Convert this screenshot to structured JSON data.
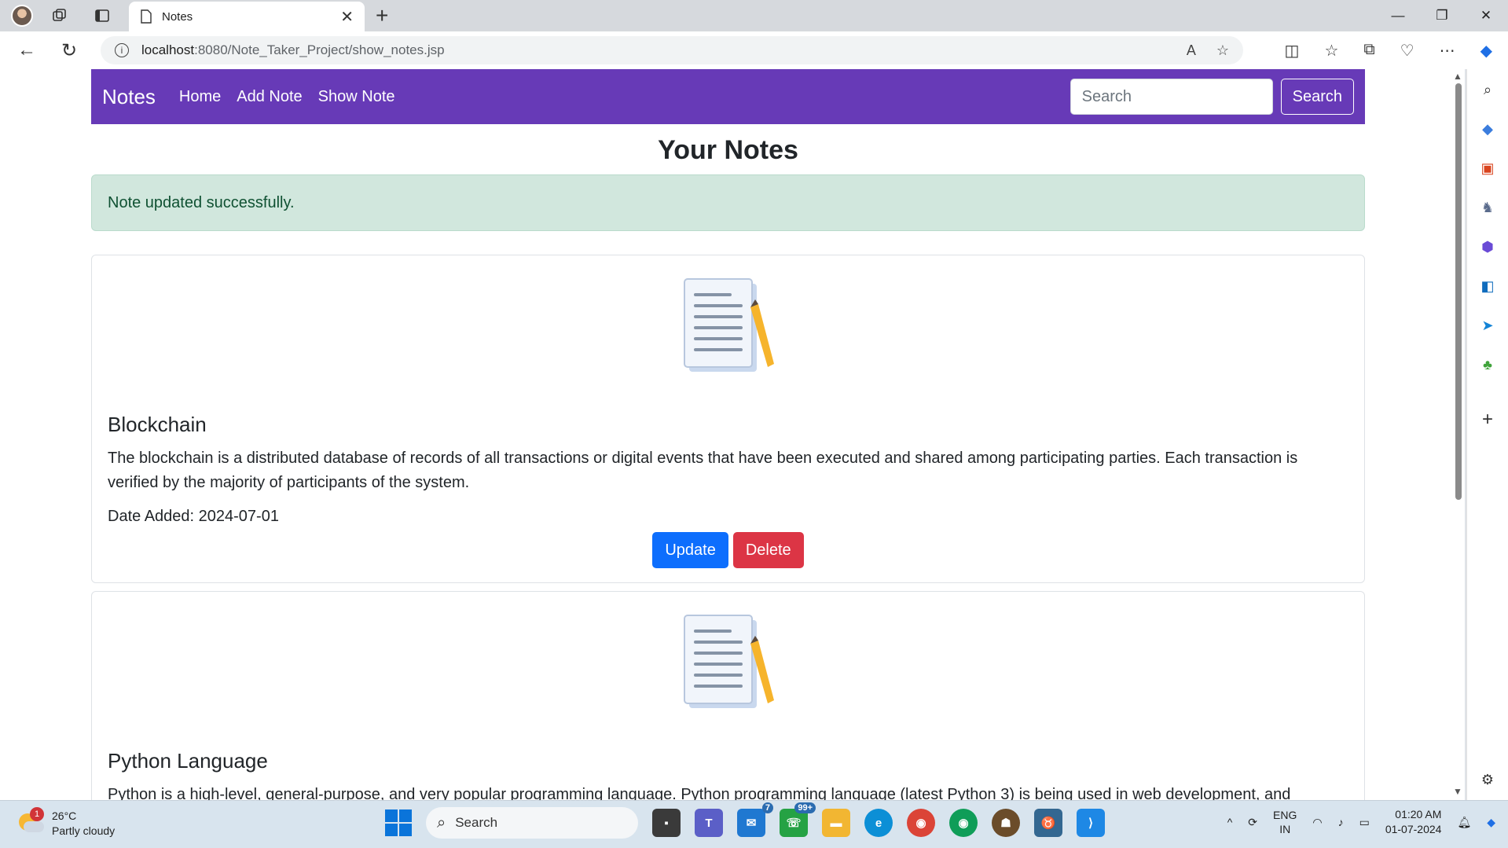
{
  "browser": {
    "tab_title": "Notes",
    "tab_close": "✕",
    "new_tab": "+",
    "url_host": "localhost",
    "url_path": ":8080/Note_Taker_Project/show_notes.jsp",
    "window_controls": [
      "—",
      "❐",
      "✕"
    ]
  },
  "navbar": {
    "brand": "Notes",
    "links": [
      "Home",
      "Add Note",
      "Show Note"
    ],
    "search_placeholder": "Search",
    "search_button": "Search",
    "background_color": "#673ab7"
  },
  "page": {
    "title": "Your Notes",
    "alert": "Note updated successfully."
  },
  "notes": [
    {
      "title": "Blockchain",
      "content": "The blockchain is a distributed database of records of all transactions or digital events that have been executed and shared among participating parties. Each transaction is verified by the majority of participants of the system.",
      "date": "Date Added: 2024-07-01",
      "update_label": "Update",
      "delete_label": "Delete"
    },
    {
      "title": "Python Language",
      "content": "Python is a high-level, general-purpose, and very popular programming language. Python programming language (latest Python 3) is being used in web development, and"
    }
  ],
  "taskbar": {
    "weather_badge": "1",
    "temperature": "26°C",
    "weather_desc": "Partly cloudy",
    "search_label": "Search",
    "mail_count": "7",
    "whatsapp_count": "99+",
    "lang_line1": "ENG",
    "lang_line2": "IN",
    "time": "01:20 AM",
    "date": "01-07-2024"
  },
  "colors": {
    "primary": "#0d6efd",
    "danger": "#dc3545",
    "alert_bg": "#d1e7dd",
    "alert_text": "#0f5132"
  }
}
